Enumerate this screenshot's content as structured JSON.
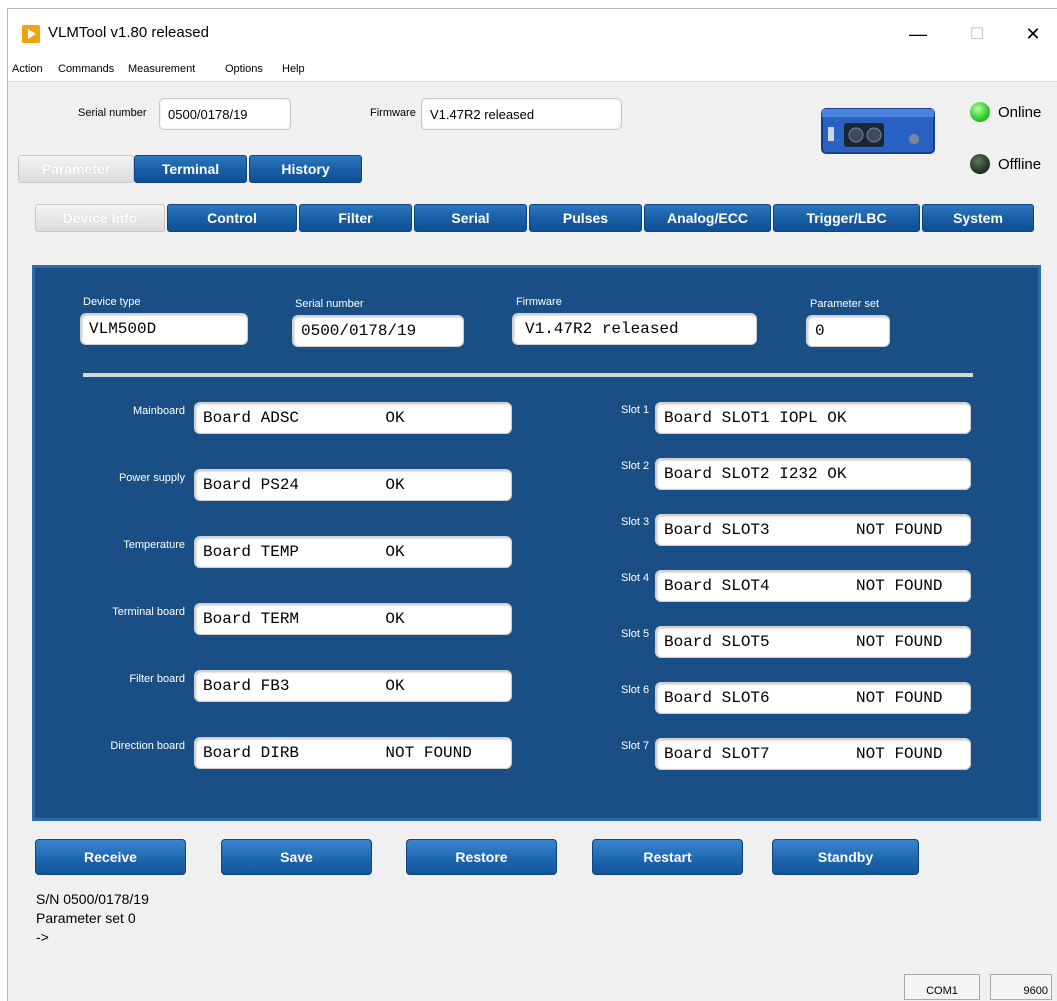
{
  "window": {
    "title": "VLMTool  v1.80 released",
    "minimize_glyph": "—",
    "maximize_glyph": "☐",
    "close_glyph": "✕"
  },
  "menu": [
    "Action",
    "Commands",
    "Measurement",
    "Options",
    "Help"
  ],
  "header": {
    "serial_label": "Serial number",
    "serial_value": "0500/0178/19",
    "firmware_label": "Firmware",
    "firmware_value": "V1.47R2 released",
    "online_label": "Online",
    "offline_label": "Offline"
  },
  "main_tabs": [
    "Parameter",
    "Terminal",
    "History"
  ],
  "sub_tabs": [
    "Device Info",
    "Control",
    "Filter",
    "Serial",
    "Pulses",
    "Analog/ECC",
    "Trigger/LBC",
    "System"
  ],
  "device_info": {
    "device_type_label": "Device type",
    "device_type_value": "VLM500D",
    "serial_label": "Serial number",
    "serial_value": "0500/0178/19",
    "firmware_label": "Firmware",
    "firmware_value": "V1.47R2 released",
    "paramset_label": "Parameter set",
    "paramset_value": "0"
  },
  "boards": [
    {
      "label": "Mainboard",
      "value": "Board ADSC         OK"
    },
    {
      "label": "Power supply",
      "value": "Board PS24         OK"
    },
    {
      "label": "Temperature",
      "value": "Board TEMP         OK"
    },
    {
      "label": "Terminal board",
      "value": "Board TERM         OK"
    },
    {
      "label": "Filter board",
      "value": "Board FB3          OK"
    },
    {
      "label": "Direction board",
      "value": "Board DIRB         NOT FOUND"
    }
  ],
  "slots": [
    {
      "label": "Slot 1",
      "value": "Board SLOT1 IOPL OK"
    },
    {
      "label": "Slot 2",
      "value": "Board SLOT2 I232 OK"
    },
    {
      "label": "Slot 3",
      "value": "Board SLOT3         NOT FOUND"
    },
    {
      "label": "Slot 4",
      "value": "Board SLOT4         NOT FOUND"
    },
    {
      "label": "Slot 5",
      "value": "Board SLOT5         NOT FOUND"
    },
    {
      "label": "Slot 6",
      "value": "Board SLOT6         NOT FOUND"
    },
    {
      "label": "Slot 7",
      "value": "Board SLOT7         NOT FOUND"
    }
  ],
  "buttons": [
    "Receive",
    "Save",
    "Restore",
    "Restart",
    "Standby"
  ],
  "status": {
    "line1": "S/N 0500/0178/19",
    "line2": "Parameter set 0",
    "line3": "->",
    "com_port": "COM1",
    "baud": "9600"
  },
  "colors": {
    "accent": "#1a5fa6",
    "panel": "#1a4f86",
    "online_led": "#2fcf2f",
    "offline_led": "#1f3a1f",
    "logo": "#f2a10f"
  },
  "icons": [
    "app-logo-icon",
    "online-led-icon",
    "offline-led-icon",
    "device-image"
  ]
}
